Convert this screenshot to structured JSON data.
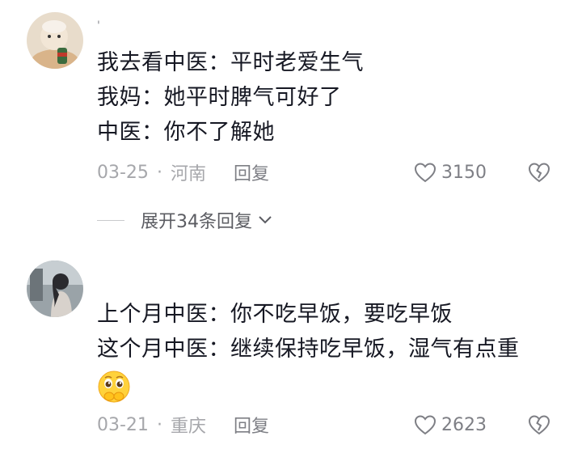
{
  "comments": [
    {
      "username": "'",
      "lines": [
        "我去看中医：平时老爱生气",
        "我妈：她平时脾气可好了",
        "中医：你不了解她"
      ],
      "date": "03-25",
      "location": "河南",
      "reply_label": "回复",
      "likes": "3150",
      "expand_label": "展开34条回复"
    },
    {
      "lines": [
        "上个月中医：你不吃早饭，要吃早饭",
        "这个月中医：继续保持吃早饭，湿气有点重"
      ],
      "emoji": "pleading-hands-face",
      "date": "03-21",
      "location": "重庆",
      "reply_label": "回复",
      "likes": "2623"
    }
  ],
  "icons": {
    "like": "heart-outline-icon",
    "dislike": "broken-heart-icon",
    "expand": "chevron-down-icon"
  },
  "colors": {
    "text": "#161823",
    "meta": "#a6a7ab",
    "action": "#7e7f85"
  }
}
